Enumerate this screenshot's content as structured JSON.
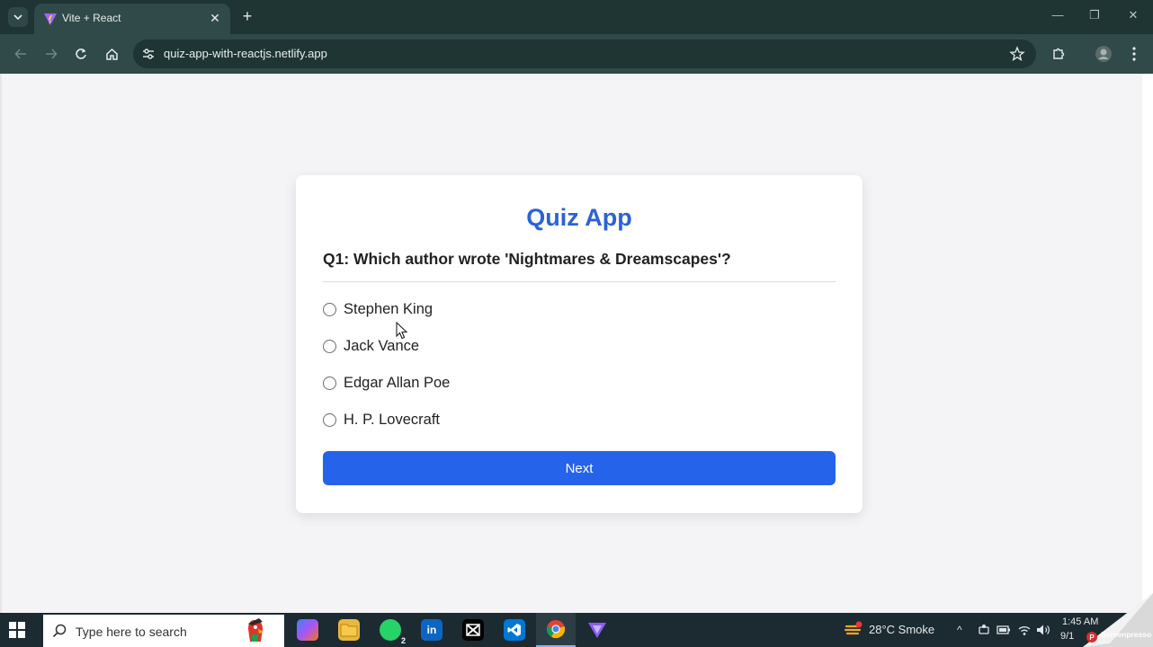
{
  "browser": {
    "tab_title": "Vite + React",
    "url": "quiz-app-with-reactjs.netlify.app"
  },
  "quiz": {
    "title": "Quiz App",
    "question": "Q1: Which author wrote 'Nightmares & Dreamscapes'?",
    "options": [
      "Stephen King",
      "Jack Vance",
      "Edgar Allan Poe",
      "H. P. Lovecraft"
    ],
    "next_label": "Next"
  },
  "taskbar": {
    "search_placeholder": "Type here to search",
    "whatsapp_badge": "2",
    "weather": "28°C  Smoke",
    "time": "1:45 AM",
    "date": "9/1",
    "watermark": "Screenpresso"
  },
  "colors": {
    "accent": "#2563eb",
    "title": "#2a63d6",
    "chrome_dark": "#1e3534",
    "chrome_toolbar": "#2f4a49"
  }
}
